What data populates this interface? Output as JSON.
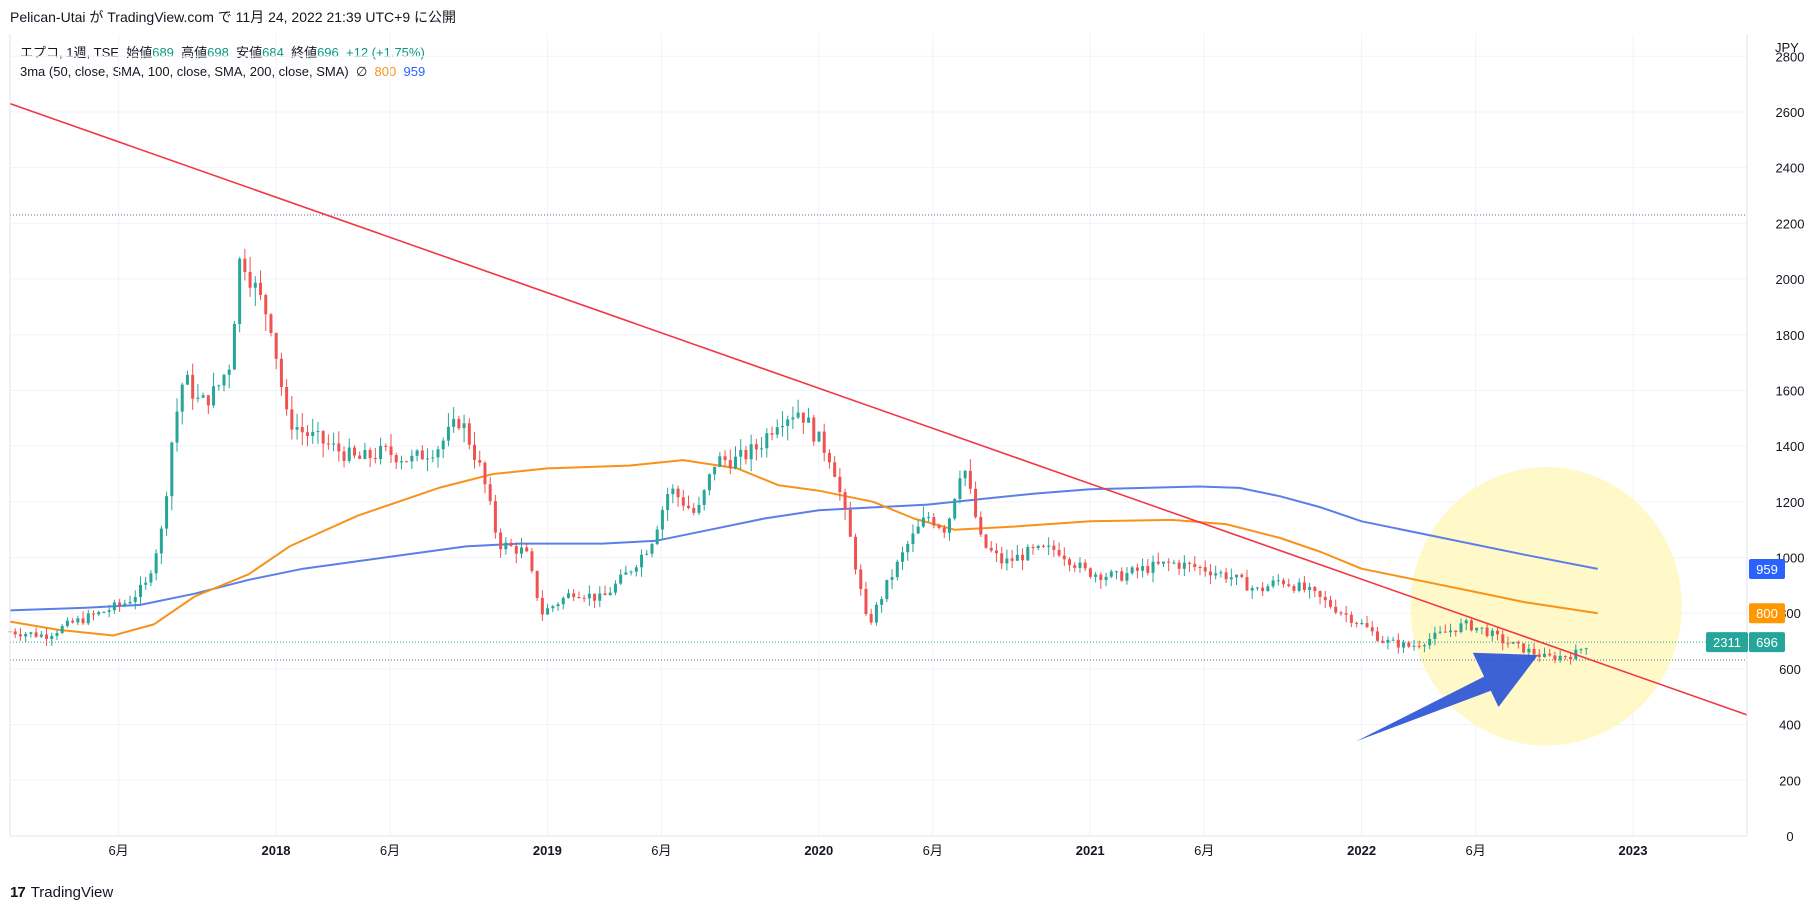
{
  "header": {
    "published": "Pelican-Utai が TradingView.com で 11月 24, 2022 21:39 UTC+9 に公開"
  },
  "legend": {
    "symbol": "エプコ, 1週, TSE",
    "open_label": "始値",
    "open": "689",
    "high_label": "高値",
    "high": "698",
    "low_label": "安値",
    "low": "684",
    "close_label": "終値",
    "close": "696",
    "change": "+12 (+1.75%)",
    "ma_label": "3ma (50, close, SMA, 100, close, SMA, 200, close, SMA)",
    "ma_symbol": "∅",
    "ma100": "800",
    "ma200": "959"
  },
  "footer": {
    "logo": "17",
    "brand": "TradingView"
  },
  "colors": {
    "up": "#26a69a",
    "down": "#ef5350",
    "ma100": "#f7931a",
    "ma200": "#5b7fe8",
    "trendline": "#f23645",
    "arrow": "#2b55d6",
    "highlight": "#fff7c2",
    "grid": "#f0f3fa"
  },
  "chart_data": {
    "type": "candlestick",
    "currency": "JPY",
    "y_ticks": [
      0,
      200,
      400,
      600,
      800,
      1000,
      1200,
      1400,
      1600,
      1800,
      2000,
      2200,
      2400,
      2600,
      2800
    ],
    "ylim": [
      0,
      2800
    ],
    "x_ticks": [
      {
        "label": "6月",
        "t": 2017.42,
        "bold": false
      },
      {
        "label": "2018",
        "t": 2018.0,
        "bold": true
      },
      {
        "label": "6月",
        "t": 2018.42,
        "bold": false
      },
      {
        "label": "2019",
        "t": 2019.0,
        "bold": true
      },
      {
        "label": "6月",
        "t": 2019.42,
        "bold": false
      },
      {
        "label": "2020",
        "t": 2020.0,
        "bold": true
      },
      {
        "label": "6月",
        "t": 2020.42,
        "bold": false
      },
      {
        "label": "2021",
        "t": 2021.0,
        "bold": true
      },
      {
        "label": "6月",
        "t": 2021.42,
        "bold": false
      },
      {
        "label": "2022",
        "t": 2022.0,
        "bold": true
      },
      {
        "label": "6月",
        "t": 2022.42,
        "bold": false
      },
      {
        "label": "2023",
        "t": 2023.0,
        "bold": true
      }
    ],
    "xlim": [
      2017.02,
      2023.42
    ],
    "price_path": [
      [
        2017.02,
        735
      ],
      [
        2017.15,
        720
      ],
      [
        2017.25,
        765
      ],
      [
        2017.35,
        800
      ],
      [
        2017.45,
        840
      ],
      [
        2017.52,
        900
      ],
      [
        2017.58,
        1100
      ],
      [
        2017.62,
        1450
      ],
      [
        2017.66,
        1650
      ],
      [
        2017.72,
        1550
      ],
      [
        2017.78,
        1600
      ],
      [
        2017.83,
        1700
      ],
      [
        2017.87,
        2100
      ],
      [
        2017.93,
        1950
      ],
      [
        2017.98,
        1850
      ],
      [
        2018.04,
        1500
      ],
      [
        2018.1,
        1450
      ],
      [
        2018.2,
        1400
      ],
      [
        2018.3,
        1350
      ],
      [
        2018.4,
        1380
      ],
      [
        2018.5,
        1350
      ],
      [
        2018.6,
        1400
      ],
      [
        2018.68,
        1500
      ],
      [
        2018.76,
        1300
      ],
      [
        2018.82,
        1050
      ],
      [
        2018.92,
        1020
      ],
      [
        2018.98,
        800
      ],
      [
        2019.1,
        880
      ],
      [
        2019.2,
        850
      ],
      [
        2019.3,
        950
      ],
      [
        2019.38,
        1050
      ],
      [
        2019.45,
        1250
      ],
      [
        2019.55,
        1150
      ],
      [
        2019.62,
        1350
      ],
      [
        2019.7,
        1350
      ],
      [
        2019.78,
        1400
      ],
      [
        2019.85,
        1500
      ],
      [
        2019.93,
        1530
      ],
      [
        2019.98,
        1450
      ],
      [
        2020.05,
        1350
      ],
      [
        2020.12,
        1050
      ],
      [
        2020.18,
        750
      ],
      [
        2020.25,
        900
      ],
      [
        2020.33,
        1050
      ],
      [
        2020.4,
        1150
      ],
      [
        2020.47,
        1100
      ],
      [
        2020.53,
        1350
      ],
      [
        2020.6,
        1050
      ],
      [
        2020.68,
        980
      ],
      [
        2020.78,
        1020
      ],
      [
        2020.88,
        1030
      ],
      [
        2020.98,
        950
      ],
      [
        2021.1,
        930
      ],
      [
        2021.2,
        960
      ],
      [
        2021.3,
        980
      ],
      [
        2021.42,
        960
      ],
      [
        2021.52,
        930
      ],
      [
        2021.62,
        880
      ],
      [
        2021.7,
        920
      ],
      [
        2021.8,
        880
      ],
      [
        2021.9,
        820
      ],
      [
        2022.0,
        760
      ],
      [
        2022.08,
        700
      ],
      [
        2022.18,
        680
      ],
      [
        2022.28,
        720
      ],
      [
        2022.38,
        760
      ],
      [
        2022.45,
        740
      ],
      [
        2022.52,
        700
      ],
      [
        2022.6,
        670
      ],
      [
        2022.68,
        640
      ],
      [
        2022.78,
        650
      ],
      [
        2022.84,
        696
      ]
    ],
    "ma100": [
      [
        2017.02,
        770
      ],
      [
        2017.2,
        740
      ],
      [
        2017.4,
        720
      ],
      [
        2017.55,
        760
      ],
      [
        2017.7,
        860
      ],
      [
        2017.9,
        940
      ],
      [
        2018.05,
        1040
      ],
      [
        2018.3,
        1150
      ],
      [
        2018.6,
        1250
      ],
      [
        2018.8,
        1300
      ],
      [
        2019.0,
        1320
      ],
      [
        2019.3,
        1330
      ],
      [
        2019.5,
        1350
      ],
      [
        2019.7,
        1320
      ],
      [
        2019.85,
        1260
      ],
      [
        2020.0,
        1240
      ],
      [
        2020.2,
        1200
      ],
      [
        2020.35,
        1140
      ],
      [
        2020.5,
        1100
      ],
      [
        2020.7,
        1110
      ],
      [
        2021.0,
        1130
      ],
      [
        2021.3,
        1135
      ],
      [
        2021.5,
        1120
      ],
      [
        2021.7,
        1070
      ],
      [
        2021.85,
        1020
      ],
      [
        2022.0,
        960
      ],
      [
        2022.2,
        920
      ],
      [
        2022.4,
        880
      ],
      [
        2022.6,
        840
      ],
      [
        2022.87,
        800
      ]
    ],
    "ma200": [
      [
        2017.02,
        810
      ],
      [
        2017.3,
        820
      ],
      [
        2017.5,
        830
      ],
      [
        2017.7,
        870
      ],
      [
        2017.9,
        920
      ],
      [
        2018.1,
        960
      ],
      [
        2018.4,
        1000
      ],
      [
        2018.7,
        1040
      ],
      [
        2018.9,
        1050
      ],
      [
        2019.2,
        1050
      ],
      [
        2019.4,
        1060
      ],
      [
        2019.6,
        1100
      ],
      [
        2019.8,
        1140
      ],
      [
        2020.0,
        1170
      ],
      [
        2020.2,
        1180
      ],
      [
        2020.4,
        1190
      ],
      [
        2020.6,
        1210
      ],
      [
        2020.8,
        1230
      ],
      [
        2021.0,
        1245
      ],
      [
        2021.2,
        1250
      ],
      [
        2021.4,
        1255
      ],
      [
        2021.55,
        1250
      ],
      [
        2021.7,
        1220
      ],
      [
        2021.85,
        1180
      ],
      [
        2022.0,
        1130
      ],
      [
        2022.3,
        1070
      ],
      [
        2022.6,
        1010
      ],
      [
        2022.87,
        959
      ]
    ],
    "trendline": [
      [
        2017.02,
        2630
      ],
      [
        2023.42,
        435
      ]
    ],
    "hlines": [
      {
        "y": 2230,
        "color": "#4a6f8a"
      },
      {
        "y": 696,
        "color": "#26a69a"
      },
      {
        "y": 632,
        "color": "#4a6f8a"
      }
    ],
    "badges": [
      {
        "value": "959",
        "y": 959,
        "color": "#2962ff"
      },
      {
        "value": "800",
        "y": 800,
        "color": "#ff9800"
      },
      {
        "value": "696",
        "y": 696,
        "color": "#26a69a"
      }
    ],
    "countdown": "2311",
    "arrow": {
      "from": [
        2021.98,
        340
      ],
      "to": [
        2022.65,
        650
      ]
    },
    "highlight": {
      "center": [
        2022.68,
        825
      ],
      "radius_t": 0.5,
      "radius_y": 500
    }
  }
}
